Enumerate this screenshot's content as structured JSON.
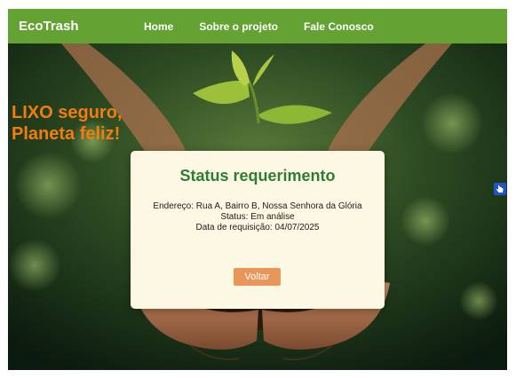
{
  "navbar": {
    "brand": "EcoTrash",
    "links": [
      "Home",
      "Sobre o projeto",
      "Fale Conosco"
    ]
  },
  "hero": {
    "slogan_line1": "LIXO seguro,",
    "slogan_line2": "Planeta feliz!"
  },
  "card": {
    "title": "Status requerimento",
    "address": "Endereço: Rua A, Bairro B, Nossa Senhora da Glória",
    "status": "Status: Em análise",
    "request_date": "Data de requisição: 04/07/2025",
    "back_label": "Voltar"
  },
  "colors": {
    "navbar": "#64a234",
    "slogan": "#f27d0c",
    "card_bg": "#fdf8e4",
    "title": "#2e7d32",
    "button": "#e8965a"
  },
  "icons": {
    "accessibility_widget": "hand-pointer-icon"
  }
}
